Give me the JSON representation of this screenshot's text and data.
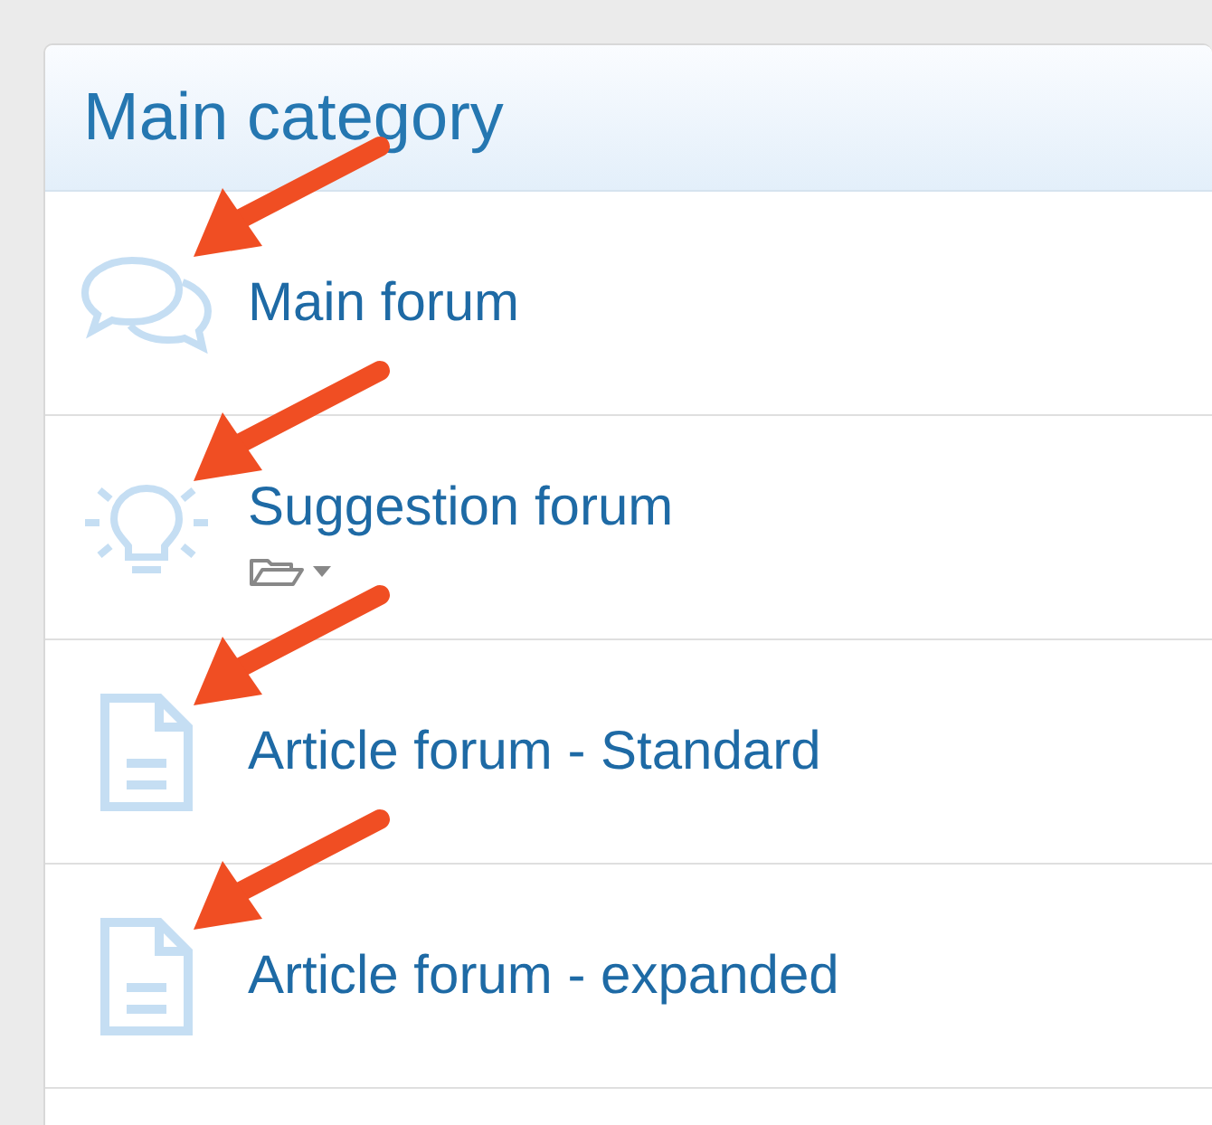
{
  "category": {
    "title": "Main category"
  },
  "forums": [
    {
      "kind": "chat",
      "title": "Main forum",
      "has_subforums": false,
      "annotated": true
    },
    {
      "kind": "bulb",
      "title": "Suggestion forum",
      "has_subforums": true,
      "annotated": true
    },
    {
      "kind": "document",
      "title": "Article forum - Standard",
      "has_subforums": false,
      "annotated": true
    },
    {
      "kind": "document",
      "title": "Article forum - expanded",
      "has_subforums": false,
      "annotated": true
    }
  ]
}
